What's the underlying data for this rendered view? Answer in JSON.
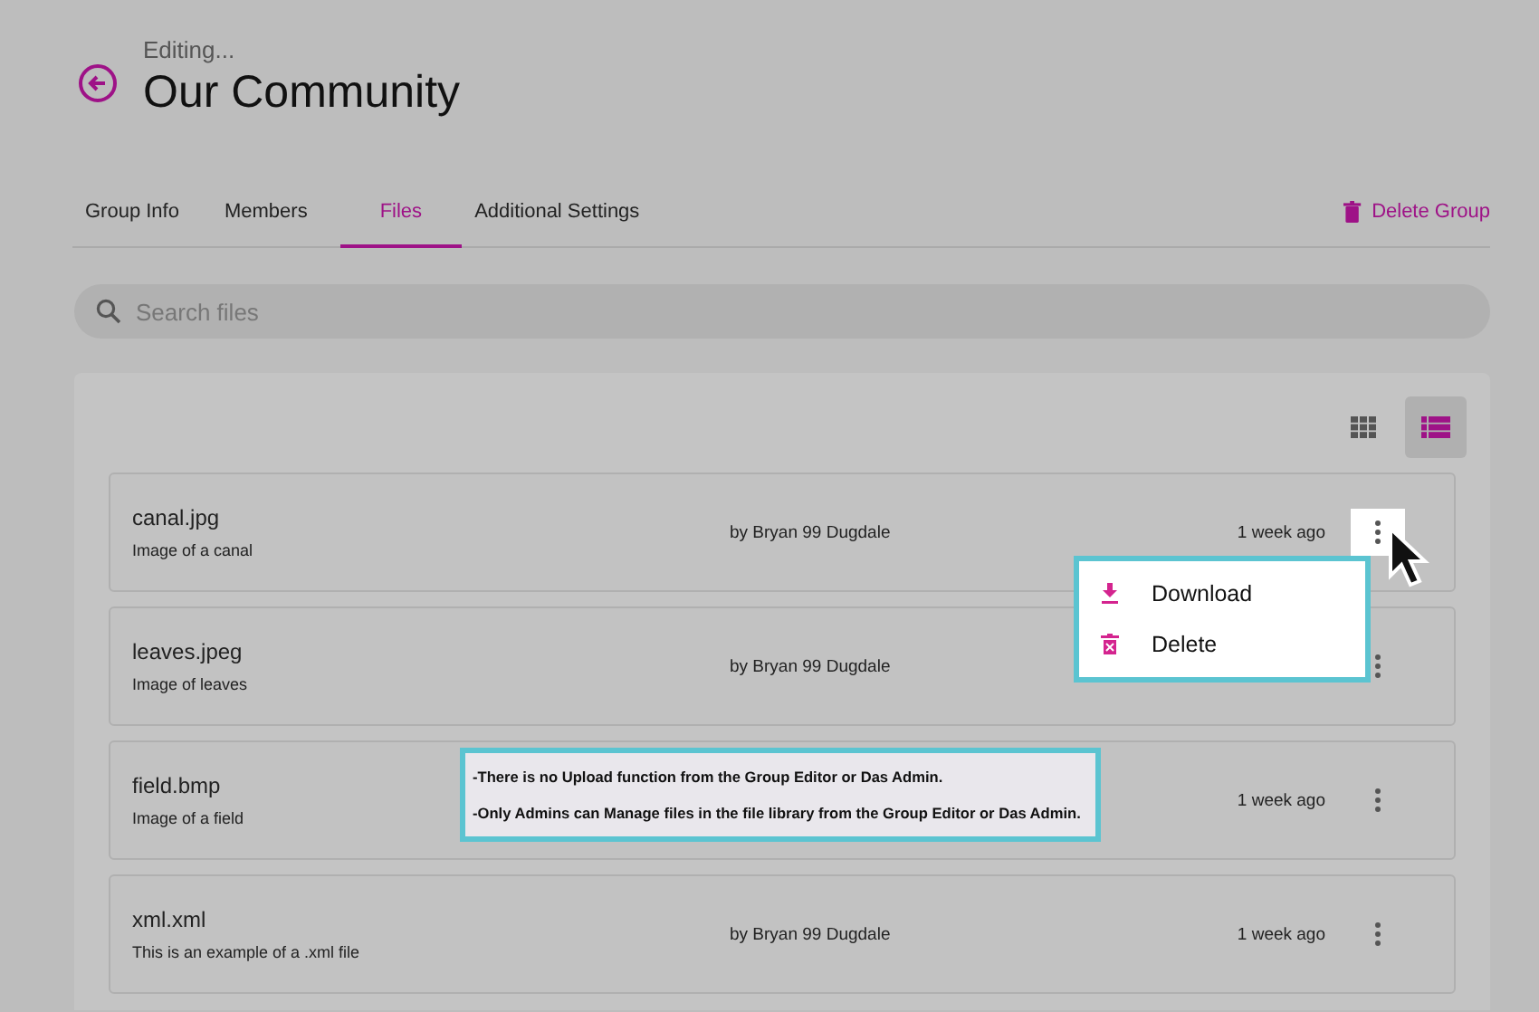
{
  "header": {
    "subtitle": "Editing...",
    "title": "Our Community"
  },
  "tabs": [
    {
      "label": "Group Info",
      "selected": false
    },
    {
      "label": "Members",
      "selected": false
    },
    {
      "label": "Files",
      "selected": true
    },
    {
      "label": "Additional Settings",
      "selected": false
    }
  ],
  "delete_group": "Delete Group",
  "search": {
    "placeholder": "Search files"
  },
  "view_toggle": [
    {
      "kind": "grid",
      "selected": false
    },
    {
      "kind": "list",
      "selected": true
    }
  ],
  "files": [
    {
      "name": "canal.jpg",
      "description": "Image of a canal",
      "author": "by Bryan 99 Dugdale",
      "time": "1 week ago",
      "menu_open": true
    },
    {
      "name": "leaves.jpeg",
      "description": "Image of leaves",
      "author": "by Bryan 99 Dugdale",
      "menu_open": false
    },
    {
      "name": "field.bmp",
      "description": "Image of a field",
      "time": "1 week ago",
      "menu_open": false
    },
    {
      "name": "xml.xml",
      "description": "This is an example of a .xml file",
      "author": "by Bryan 99 Dugdale",
      "time": "1 week ago",
      "menu_open": false
    }
  ],
  "menu": [
    {
      "kind": "download",
      "label": "Download"
    },
    {
      "kind": "delete",
      "label": "Delete"
    }
  ],
  "note": [
    "-There is no Upload function from the Group Editor or Das Admin.",
    "-Only Admins can Manage files in the file library from the Group Editor or Das Admin."
  ]
}
